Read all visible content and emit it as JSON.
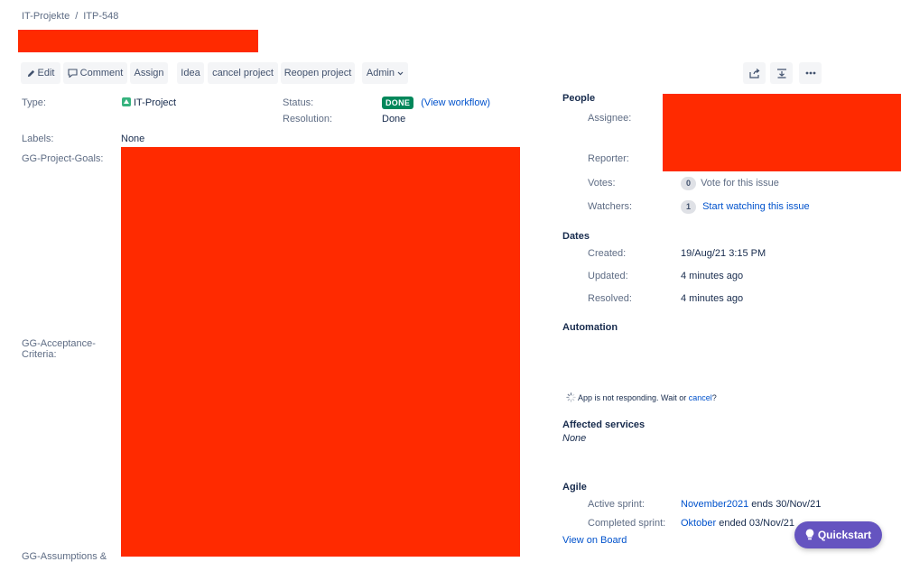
{
  "breadcrumb": {
    "project": "IT-Projekte",
    "separator": "/",
    "issue_key": "ITP-548"
  },
  "toolbar": {
    "edit": "Edit",
    "comment": "Comment",
    "assign": "Assign",
    "idea": "Idea",
    "cancel_project": "cancel project",
    "reopen_project": "Reopen project",
    "admin": "Admin",
    "share_icon": "share-icon",
    "export_icon": "export-icon",
    "more_icon": "more-icon"
  },
  "details": {
    "type_label": "Type:",
    "type_value": "IT-Project",
    "status_label": "Status:",
    "status_value": "DONE",
    "view_workflow": "(View workflow)",
    "resolution_label": "Resolution:",
    "resolution_value": "Done",
    "labels_label": "Labels:",
    "labels_value": "None",
    "project_goals_label": "GG-Project-Goals:",
    "acceptance_label": "GG-Acceptance-Criteria:",
    "acceptance_line1": "GG-Acceptance-",
    "acceptance_line2": "Criteria:",
    "assumptions_label": "GG-Assumptions &"
  },
  "people": {
    "heading": "People",
    "assignee_label": "Assignee:",
    "reporter_label": "Reporter:",
    "votes_label": "Votes:",
    "votes_count": "0",
    "votes_text": "Vote for this issue",
    "watchers_label": "Watchers:",
    "watchers_count": "1",
    "watchers_text": "Start watching this issue"
  },
  "dates": {
    "heading": "Dates",
    "created_label": "Created:",
    "created_value": "19/Aug/21 3:15 PM",
    "updated_label": "Updated:",
    "updated_value": "4 minutes ago",
    "resolved_label": "Resolved:",
    "resolved_value": "4 minutes ago"
  },
  "automation": {
    "heading": "Automation",
    "message": "App is not responding. Wait or",
    "cancel_link": "cancel",
    "suffix": "?"
  },
  "affected_services": {
    "heading": "Affected services",
    "value": "None"
  },
  "agile": {
    "heading": "Agile",
    "active_label": "Active sprint:",
    "active_sprint": "November2021",
    "active_suffix": "ends 30/Nov/21",
    "completed_label": "Completed sprint:",
    "completed_sprint": "Oktober",
    "completed_suffix": "ended 03/Nov/21",
    "view_on_board": "View on Board"
  },
  "quickstart": {
    "label": "Quickstart",
    "icon": "lightbulb-icon"
  },
  "colors": {
    "redaction": "#ff2a00",
    "done_lozenge": "#00875a",
    "link": "#0052cc",
    "quickstart": "#6554c0"
  }
}
